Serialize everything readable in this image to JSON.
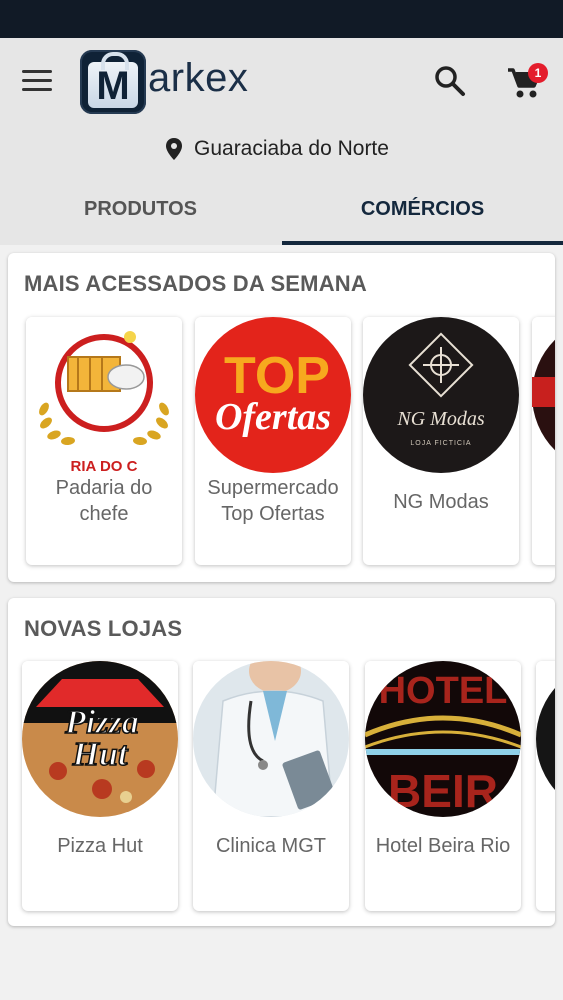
{
  "app": {
    "logo_text": "arkex",
    "logo_letter": "M"
  },
  "header": {
    "cart_count": "1",
    "location": "Guaraciaba do Norte"
  },
  "tabs": [
    {
      "label": "PRODUTOS",
      "active": false
    },
    {
      "label": "COMÉRCIOS",
      "active": true
    }
  ],
  "sections": [
    {
      "title": "MAIS ACESSADOS DA SEMANA",
      "shops": [
        {
          "name": "Padaria do chefe",
          "logo_text": "RIA DO C"
        },
        {
          "name": "Supermercado Top Ofertas",
          "logo_line1": "TOP",
          "logo_line2": "Ofertas"
        },
        {
          "name": "NG Modas",
          "logo_line1": "NG Modas",
          "logo_line2": "LOJA FICTICIA"
        }
      ]
    },
    {
      "title": "NOVAS LOJAS",
      "shops": [
        {
          "name": "Pizza Hut",
          "logo_line1": "Pizza",
          "logo_line2": "Hut"
        },
        {
          "name": "Clinica MGT"
        },
        {
          "name": "Hotel Beira Rio",
          "logo_line1": "HOTEL",
          "logo_line2": "BEIR"
        }
      ]
    }
  ],
  "colors": {
    "primary": "#14283d",
    "statusbar": "#111a26",
    "appbar": "#e6e6e6",
    "badge": "#e41d2c"
  }
}
